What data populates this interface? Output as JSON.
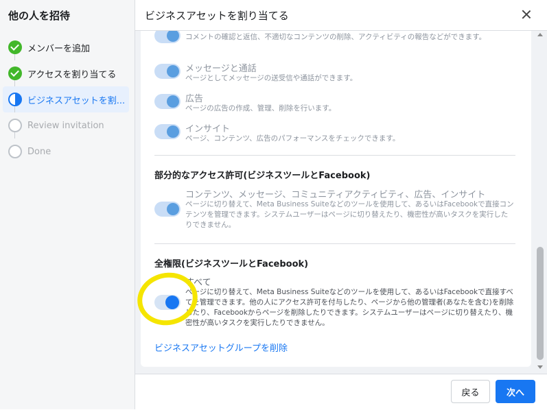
{
  "sidebar": {
    "title": "他の人を招待",
    "steps": [
      {
        "label": "メンバーを追加",
        "state": "done"
      },
      {
        "label": "アクセスを割り当てる",
        "state": "done"
      },
      {
        "label": "ビジネスアセットを割...",
        "state": "current"
      },
      {
        "label": "Review invitation",
        "state": "pending"
      },
      {
        "label": "Done",
        "state": "pending"
      }
    ]
  },
  "header": {
    "title": "ビジネスアセットを割り当てる"
  },
  "permissions_top": [
    {
      "title": "",
      "desc": "コメントの確認と返信、不適切なコンテンツの削除、アクティビティの報告などができます。"
    },
    {
      "title": "メッセージと通話",
      "desc": "ページとしてメッセージの送受信や通話ができます。"
    },
    {
      "title": "広告",
      "desc": "ページの広告の作成、管理、削除を行います。"
    },
    {
      "title": "インサイト",
      "desc": "ページ、コンテンツ、広告のパフォーマンスをチェックできます。"
    }
  ],
  "partial": {
    "heading": "部分的なアクセス許可(ビジネスツールとFacebook)",
    "title": "コンテンツ、メッセージ、コミュニティアクティビティ、広告、インサイト",
    "desc": "ページに切り替えて、Meta Business Suiteなどのツールを使用して、あるいはFacebookで直接コンテンツを管理できます。システムユーザーはページに切り替えたり、機密性が高いタスクを実行したりできません。"
  },
  "full": {
    "heading": "全権限(ビジネスツールとFacebook)",
    "title": "すべて",
    "desc": "ページに切り替えて、Meta Business Suiteなどのツールを使用して、あるいはFacebookで直接すべてを管理できます。他の人にアクセス許可を付与したり、ページから他の管理者(あなたを含む)を削除したり、Facebookからページを削除したりできます。システムユーザーはページに切り替えたり、機密性が高いタスクを実行したりできません。",
    "enabled": true
  },
  "remove_link": "ビジネスアセットグループを削除",
  "footer": {
    "back_label": "戻る",
    "next_label": "次へ"
  },
  "colors": {
    "accent": "#1877f2",
    "success": "#42b72a",
    "highlight": "#f5e500"
  }
}
